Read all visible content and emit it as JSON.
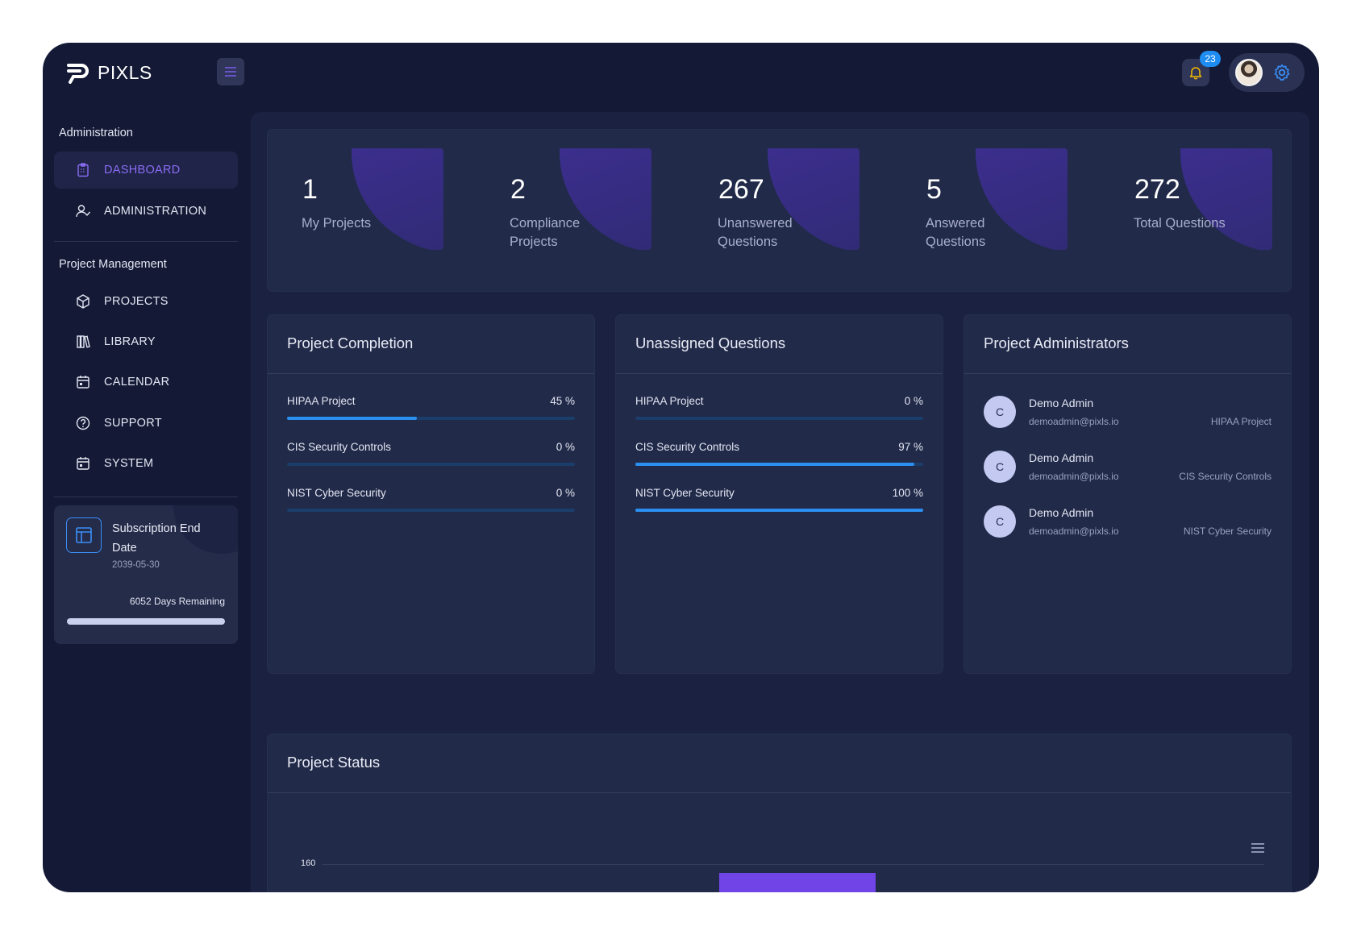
{
  "brand": {
    "name": "PIXLS"
  },
  "sidebar": {
    "section1": "Administration",
    "section2": "Project Management",
    "items": [
      {
        "label": "DASHBOARD",
        "icon": "clipboard-icon"
      },
      {
        "label": "ADMINISTRATION",
        "icon": "user-check-icon"
      },
      {
        "label": "PROJECTS",
        "icon": "box-icon"
      },
      {
        "label": "LIBRARY",
        "icon": "books-icon"
      },
      {
        "label": "CALENDAR",
        "icon": "calendar-icon"
      },
      {
        "label": "SUPPORT",
        "icon": "help-circle-icon"
      },
      {
        "label": "SYSTEM",
        "icon": "calendar-icon"
      }
    ],
    "subscription": {
      "title": "Subscription End Date",
      "date": "2039-05-30",
      "remaining": "6052 Days Remaining",
      "progress": 1.0
    }
  },
  "header": {
    "notifications": "23"
  },
  "stats": [
    {
      "value": "1",
      "label": "My Projects"
    },
    {
      "value": "2",
      "label": "Compliance Projects"
    },
    {
      "value": "267",
      "label": "Unanswered Questions"
    },
    {
      "value": "5",
      "label": "Answered Questions"
    },
    {
      "value": "272",
      "label": "Total Questions"
    }
  ],
  "completion": {
    "title": "Project Completion",
    "rows": [
      {
        "name": "HIPAA Project",
        "value": "45 %",
        "pct": 45
      },
      {
        "name": "CIS Security Controls",
        "value": "0 %",
        "pct": 0
      },
      {
        "name": "NIST Cyber Security",
        "value": "0 %",
        "pct": 0
      }
    ]
  },
  "unassigned": {
    "title": "Unassigned Questions",
    "rows": [
      {
        "name": "HIPAA Project",
        "value": "0 %",
        "pct": 0
      },
      {
        "name": "CIS Security Controls",
        "value": "97 %",
        "pct": 97
      },
      {
        "name": "NIST Cyber Security",
        "value": "100 %",
        "pct": 100
      }
    ]
  },
  "admins": {
    "title": "Project Administrators",
    "rows": [
      {
        "initial": "C",
        "name": "Demo Admin",
        "email": "demoadmin@pixls.io",
        "project": "HIPAA Project"
      },
      {
        "initial": "C",
        "name": "Demo Admin",
        "email": "demoadmin@pixls.io",
        "project": "CIS Security Controls"
      },
      {
        "initial": "C",
        "name": "Demo Admin",
        "email": "demoadmin@pixls.io",
        "project": "NIST Cyber Security"
      }
    ]
  },
  "status": {
    "title": "Project Status",
    "chart_data": {
      "type": "bar",
      "y_ticks_visible": [
        "160"
      ],
      "bar_color": "#7044e6",
      "visible_bar_top_value": 150
    }
  },
  "colors": {
    "accent": "#8b6cf5",
    "progress": "#2b8ff0",
    "bg": "#141a36"
  }
}
